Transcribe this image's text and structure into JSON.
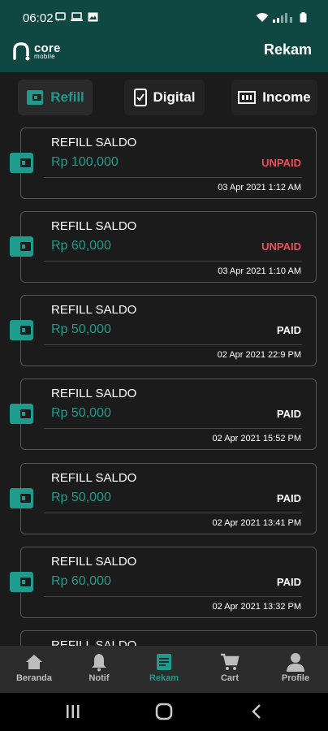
{
  "status_bar": {
    "time": "06:02"
  },
  "header": {
    "logo_main": "core",
    "logo_sub": "mobile",
    "title": "Rekam"
  },
  "tabs": [
    {
      "label": "Refill",
      "icon": "wallet-icon",
      "active": true
    },
    {
      "label": "Digital",
      "icon": "phone-icon",
      "active": false
    },
    {
      "label": "Income",
      "icon": "cash-icon",
      "active": false
    }
  ],
  "transactions": [
    {
      "title": "REFILL SALDO",
      "amount": "Rp 100,000",
      "status": "UNPAID",
      "date": "03 Apr 2021 1:12 AM"
    },
    {
      "title": "REFILL SALDO",
      "amount": "Rp 60,000",
      "status": "UNPAID",
      "date": "03 Apr 2021 1:10 AM"
    },
    {
      "title": "REFILL SALDO",
      "amount": "Rp 50,000",
      "status": "PAID",
      "date": "02 Apr 2021 22:9 PM"
    },
    {
      "title": "REFILL SALDO",
      "amount": "Rp 50,000",
      "status": "PAID",
      "date": "02 Apr 2021 15:52 PM"
    },
    {
      "title": "REFILL SALDO",
      "amount": "Rp 50,000",
      "status": "PAID",
      "date": "02 Apr 2021 13:41 PM"
    },
    {
      "title": "REFILL SALDO",
      "amount": "Rp 60,000",
      "status": "PAID",
      "date": "02 Apr 2021 13:32 PM"
    },
    {
      "title": "REFILL SALDO",
      "amount": "",
      "status": "",
      "date": ""
    }
  ],
  "bottom_nav": [
    {
      "label": "Beranda",
      "icon": "home-icon",
      "active": false
    },
    {
      "label": "Notif",
      "icon": "bell-icon",
      "active": false
    },
    {
      "label": "Rekam",
      "icon": "document-icon",
      "active": true
    },
    {
      "label": "Cart",
      "icon": "cart-icon",
      "active": false
    },
    {
      "label": "Profile",
      "icon": "person-icon",
      "active": false
    }
  ],
  "colors": {
    "header_bg": "#0f4842",
    "accent": "#1e9b8c",
    "unpaid": "#e8505b",
    "background": "#1b1b1b"
  }
}
